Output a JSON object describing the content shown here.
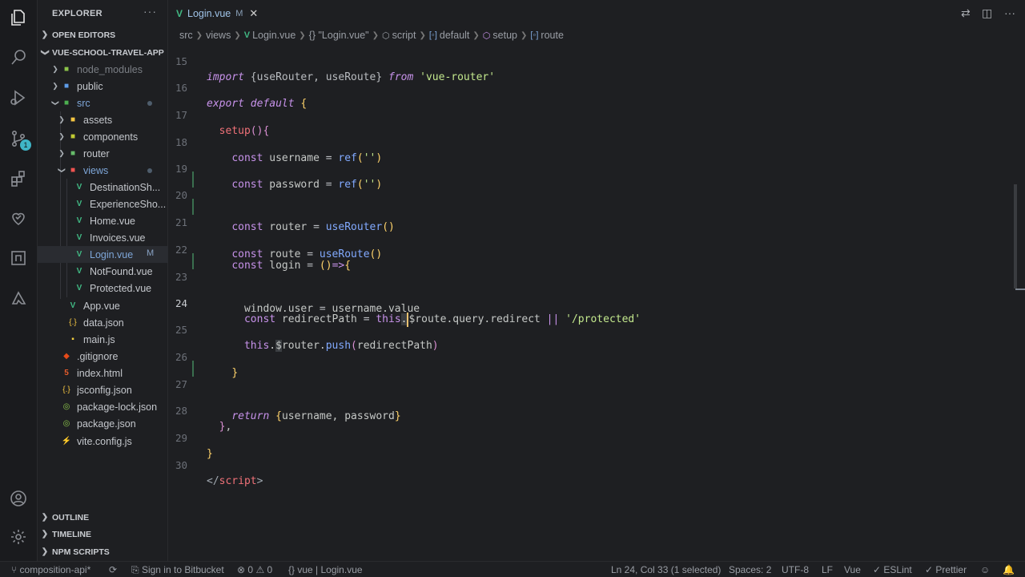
{
  "explorer": {
    "title": "EXPLORER",
    "more": "···",
    "open_editors": "OPEN EDITORS",
    "project": "VUE-SCHOOL-TRAVEL-APP",
    "tree": [
      {
        "label": "node_modules",
        "type": "folder-node"
      },
      {
        "label": "public",
        "type": "folder-public"
      },
      {
        "label": "src",
        "type": "folder-src"
      },
      {
        "label": "assets",
        "type": "folder"
      },
      {
        "label": "components",
        "type": "folder"
      },
      {
        "label": "router",
        "type": "folder-router"
      },
      {
        "label": "views",
        "type": "folder-views"
      },
      {
        "label": "DestinationSh...",
        "type": "vue"
      },
      {
        "label": "ExperienceSho...",
        "type": "vue"
      },
      {
        "label": "Home.vue",
        "type": "vue"
      },
      {
        "label": "Invoices.vue",
        "type": "vue"
      },
      {
        "label": "Login.vue",
        "type": "vue",
        "status": "M"
      },
      {
        "label": "NotFound.vue",
        "type": "vue"
      },
      {
        "label": "Protected.vue",
        "type": "vue"
      },
      {
        "label": "App.vue",
        "type": "vue"
      },
      {
        "label": "data.json",
        "type": "json"
      },
      {
        "label": "main.js",
        "type": "js"
      },
      {
        "label": ".gitignore",
        "type": "git"
      },
      {
        "label": "index.html",
        "type": "html"
      },
      {
        "label": "jsconfig.json",
        "type": "json"
      },
      {
        "label": "package-lock.json",
        "type": "npm"
      },
      {
        "label": "package.json",
        "type": "npm"
      },
      {
        "label": "vite.config.js",
        "type": "vite"
      }
    ],
    "outline": "OUTLINE",
    "timeline": "TIMELINE",
    "npm_scripts": "NPM SCRIPTS"
  },
  "activity": {
    "icons": [
      "files-icon",
      "search-icon",
      "run-debug-icon",
      "source-control-icon",
      "extensions-icon",
      "remote-explorer-icon",
      "gitlens-icon",
      "azure-icon",
      "account-icon",
      "settings-gear-icon"
    ],
    "scm_badge": "1"
  },
  "tab": {
    "label": "Login.vue",
    "status": "M",
    "close": "✕"
  },
  "breadcrumb": [
    "src",
    "views",
    "Login.vue",
    "{} \"Login.vue\"",
    "script",
    "default",
    "setup",
    "route"
  ],
  "editor": {
    "partial_line": "import {useRouter, useRoute} from 'vue-router'",
    "line_numbers": [
      "15",
      "16",
      "17",
      "18",
      "19",
      "20",
      "21",
      "22",
      "23",
      "24",
      "25",
      "26",
      "27",
      "28",
      "29",
      "30"
    ],
    "current_line": "24"
  },
  "status": {
    "branch": "composition-api*",
    "bitbucket": "Sign in to Bitbucket",
    "errors": "0",
    "warnings": "0",
    "language_crumb": "vue | Login.vue",
    "position": "Ln 24, Col 33 (1 selected)",
    "spaces": "Spaces: 2",
    "encoding": "UTF-8",
    "eol": "LF",
    "language": "Vue",
    "eslint": "ESLint",
    "prettier": "Prettier"
  },
  "colors": {
    "background": "#1e1f22",
    "keyword": "#c792ea",
    "function": "#82aaff",
    "string": "#c3e88d",
    "vue_green": "#41b883"
  }
}
